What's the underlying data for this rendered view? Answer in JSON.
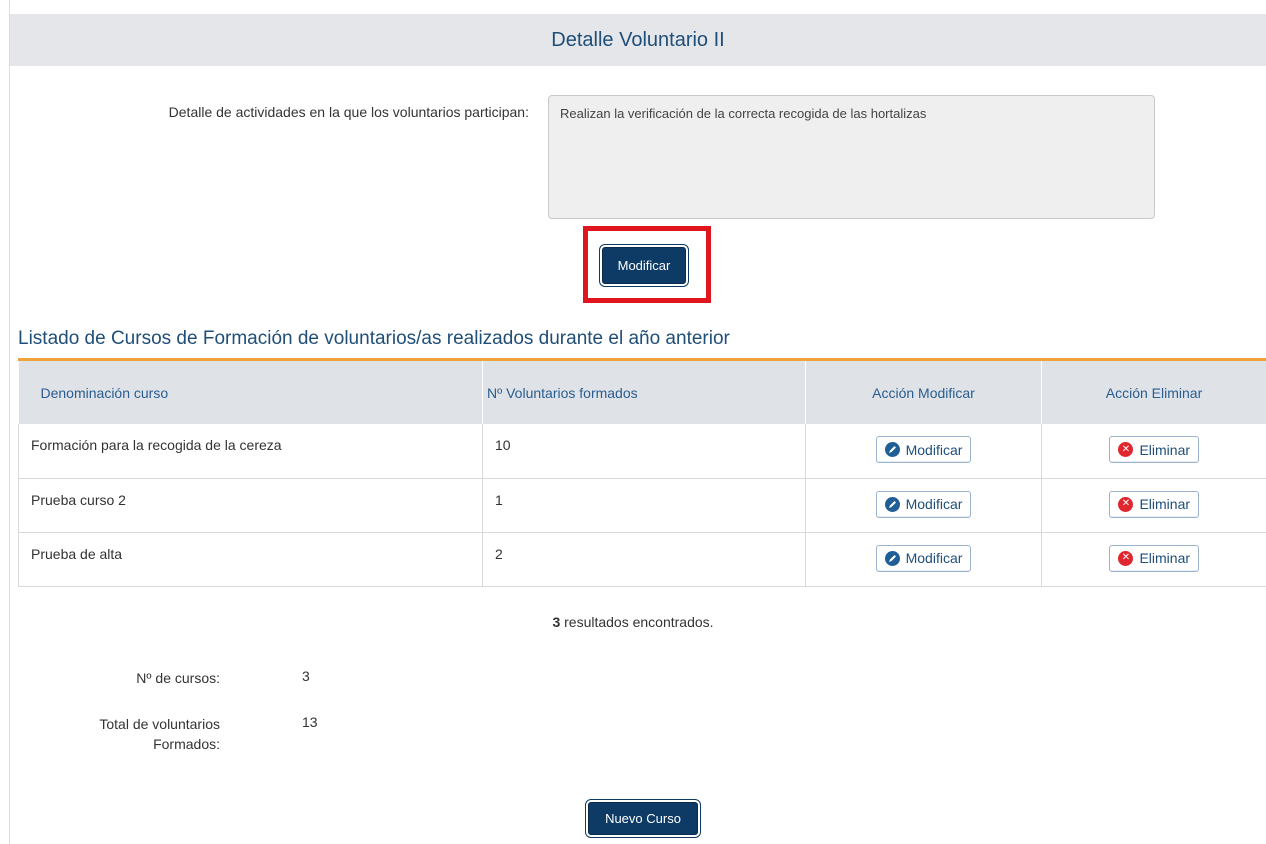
{
  "header": {
    "title": "Detalle Voluntario II"
  },
  "activity": {
    "label": "Detalle de actividades en la que los voluntarios participan:",
    "value": "Realizan la verificación de la correcta recogida de las hortalizas",
    "modify_label": "Modificar"
  },
  "courses": {
    "section_title": "Listado de Cursos de Formación de voluntarios/as realizados durante el año anterior",
    "columns": [
      "Denominación curso",
      "Nº Voluntarios formados",
      "Acción Modificar",
      "Acción Eliminar"
    ],
    "rows": [
      {
        "name": "Formación para la recogida de la cereza",
        "count": "10",
        "modify": "Modificar",
        "delete": "Eliminar"
      },
      {
        "name": "Prueba curso 2",
        "count": "1",
        "modify": "Modificar",
        "delete": "Eliminar"
      },
      {
        "name": "Prueba de alta",
        "count": "2",
        "modify": "Modificar",
        "delete": "Eliminar"
      }
    ],
    "results_count": "3",
    "results_text": " resultados encontrados."
  },
  "summary": {
    "num_courses_label": "Nº de cursos:",
    "num_courses_value": "3",
    "total_label_line1": "Total de voluntarios",
    "total_label_line2": "Formados:",
    "total_value": "13"
  },
  "actions": {
    "new_course_label": "Nuevo Curso"
  },
  "colors": {
    "accent": "#0d3b66",
    "title": "#1f4e79",
    "highlight": "#e0161f",
    "rule": "#f0a23a"
  },
  "icons": {
    "modify": "edit-icon",
    "delete": "delete-icon"
  }
}
